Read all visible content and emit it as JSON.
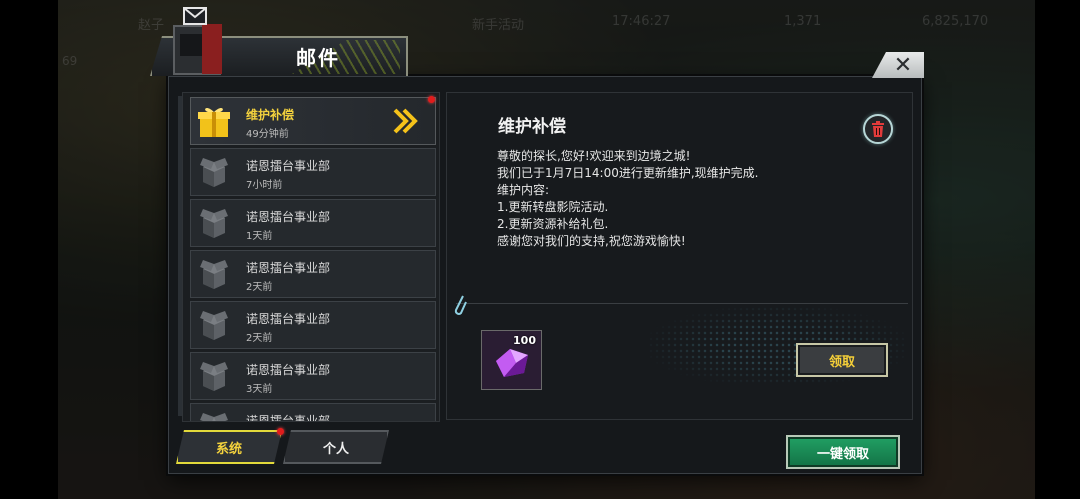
{
  "background": {
    "top_left_name": "赵子",
    "top_badge": "69",
    "event_label": "新手活动",
    "event_timer": "17:46:27",
    "resource_1": "1,371",
    "resource_2": "6,825,170"
  },
  "dialog": {
    "title": "邮件",
    "close_label": "✕"
  },
  "mail_list": [
    {
      "sender": "维护补偿",
      "time": "49分钟前",
      "icon": "gift-icon",
      "selected": true,
      "unread": true
    },
    {
      "sender": "诺恩擂台事业部",
      "time": "7小时前",
      "icon": "package-icon",
      "selected": false,
      "unread": false
    },
    {
      "sender": "诺恩擂台事业部",
      "time": "1天前",
      "icon": "package-icon",
      "selected": false,
      "unread": false
    },
    {
      "sender": "诺恩擂台事业部",
      "time": "2天前",
      "icon": "package-icon",
      "selected": false,
      "unread": false
    },
    {
      "sender": "诺恩擂台事业部",
      "time": "2天前",
      "icon": "package-icon",
      "selected": false,
      "unread": false
    },
    {
      "sender": "诺恩擂台事业部",
      "time": "3天前",
      "icon": "package-icon",
      "selected": false,
      "unread": false
    },
    {
      "sender": "诺恩擂台事业部",
      "time": "",
      "icon": "package-icon",
      "selected": false,
      "unread": false
    }
  ],
  "mail_detail": {
    "title": "维护补偿",
    "body": "尊敬的探长,您好!欢迎来到边境之城!\n我们已于1月7日14:00进行更新维护,现维护完成.\n维护内容:\n1.更新转盘影院活动.\n2.更新资源补给礼包.\n感谢您对我们的支持,祝您游戏愉快!",
    "attachment": {
      "quantity": "100",
      "icon": "purple-crystal-icon"
    },
    "claim_label": "领取"
  },
  "tabs": [
    {
      "label": "系统",
      "active": true,
      "unread": true
    },
    {
      "label": "个人",
      "active": false,
      "unread": false
    }
  ],
  "claim_all_label": "一键领取",
  "colors": {
    "accent_yellow": "#f4d23d",
    "claim_green": "#21a064",
    "unread_red": "#e11c1c"
  }
}
